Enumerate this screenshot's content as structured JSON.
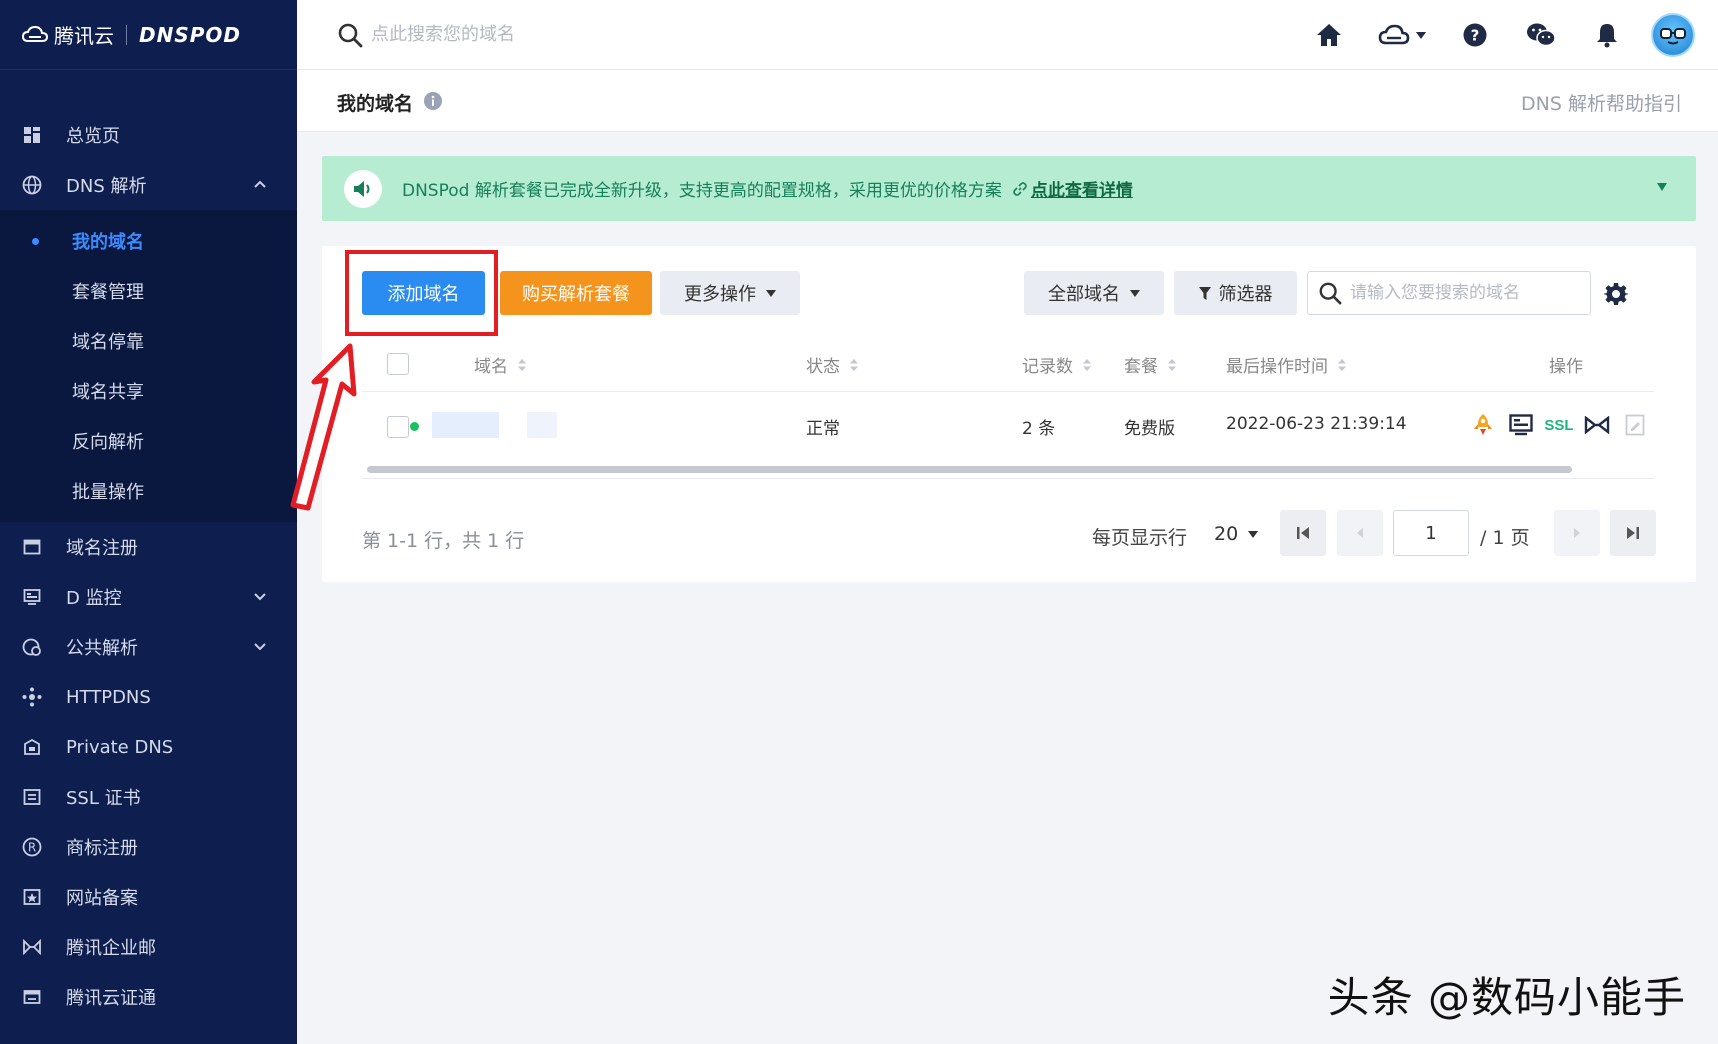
{
  "brand": {
    "name": "腾讯云",
    "product": "DNSPOD"
  },
  "sidebar": {
    "items_top": [
      {
        "label": "总览页",
        "icon": "dashboard-icon"
      },
      {
        "label": "DNS 解析",
        "icon": "globe-icon",
        "expanded": true
      }
    ],
    "sub_items": [
      {
        "label": "我的域名",
        "active": true
      },
      {
        "label": "套餐管理"
      },
      {
        "label": "域名停靠"
      },
      {
        "label": "域名共享"
      },
      {
        "label": "反向解析"
      },
      {
        "label": "批量操作"
      }
    ],
    "items_bottom": [
      {
        "label": "域名注册",
        "icon": "calendar-icon"
      },
      {
        "label": "D 监控",
        "icon": "monitor-icon"
      },
      {
        "label": "公共解析",
        "icon": "public-dns-icon"
      },
      {
        "label": "HTTPDNS",
        "icon": "network-node-icon"
      },
      {
        "label": "Private DNS",
        "icon": "building-icon"
      },
      {
        "label": "SSL 证书",
        "icon": "certificate-icon"
      },
      {
        "label": "商标注册",
        "icon": "trademark-icon"
      },
      {
        "label": "网站备案",
        "icon": "filing-icon"
      },
      {
        "label": "腾讯企业邮",
        "icon": "mail-icon"
      },
      {
        "label": "腾讯云证通",
        "icon": "id-card-icon"
      }
    ]
  },
  "topbar": {
    "search_placeholder": "点此搜索您的域名"
  },
  "page": {
    "title": "我的域名",
    "help_link": "DNS 解析帮助指引"
  },
  "banner": {
    "text": "DNSPod 解析套餐已完成全新升级，支持更高的配置规格，采用更优的价格方案",
    "link": "点此查看详情",
    "bg_color": "#b6ecd2"
  },
  "toolbar": {
    "add_domain": "添加域名",
    "buy_package": "购买解析套餐",
    "more_actions": "更多操作",
    "all_domains": "全部域名",
    "filter": "筛选器",
    "search_placeholder": "请输入您要搜索的域名"
  },
  "table": {
    "columns": [
      "域名",
      "状态",
      "记录数",
      "套餐",
      "最后操作时间",
      "操作"
    ],
    "rows": [
      {
        "domain": "",
        "status": "正常",
        "records": "2 条",
        "package": "免费版",
        "last_modified": "2022-06-23 21:39:14",
        "ops": [
          "rocket-icon",
          "monitor-icon",
          "SSL",
          "link-icon",
          "edit-icon"
        ]
      }
    ]
  },
  "pagination": {
    "summary": "第 1-1 行，共 1 行",
    "per_page_label": "每页显示行",
    "per_page": "20",
    "current_page": "1",
    "total": "/ 1 页"
  },
  "watermark": "头条 @数码小能手",
  "colors": {
    "sidebar": "#0e1e4f",
    "primary": "#2a8cf0",
    "orange": "#f5941d",
    "highlight": "#e21d23",
    "active": "#3b8cff"
  }
}
